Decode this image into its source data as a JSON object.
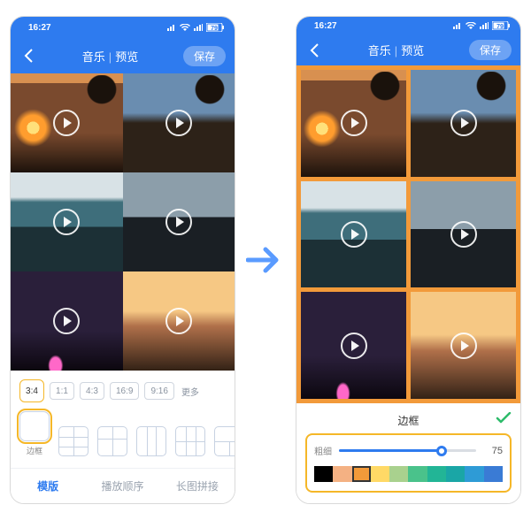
{
  "status": {
    "time": "16:27",
    "battery": "79"
  },
  "header": {
    "tabs": {
      "music": "音乐",
      "preview": "预览"
    },
    "save": "保存"
  },
  "ratios": {
    "items": [
      "3:4",
      "1:1",
      "4:3",
      "16:9",
      "9:16"
    ],
    "more": "更多",
    "selectedIndex": 0
  },
  "layouts": {
    "border_label": "边框",
    "selectedIndex": 0
  },
  "bottom_tabs": {
    "template": "模版",
    "order": "播放顺序",
    "stitch": "长图拼接",
    "activeIndex": 0
  },
  "border_panel": {
    "title": "边框",
    "thickness_label": "粗细",
    "thickness_value": "75",
    "colors": [
      "#000000",
      "#f4b183",
      "#f29a3a",
      "#ffd966",
      "#a9d18e",
      "#4ac28b",
      "#22b596",
      "#1aa6a6",
      "#2e9bd6",
      "#3a7bd5"
    ],
    "selectedColorIndex": 2
  }
}
